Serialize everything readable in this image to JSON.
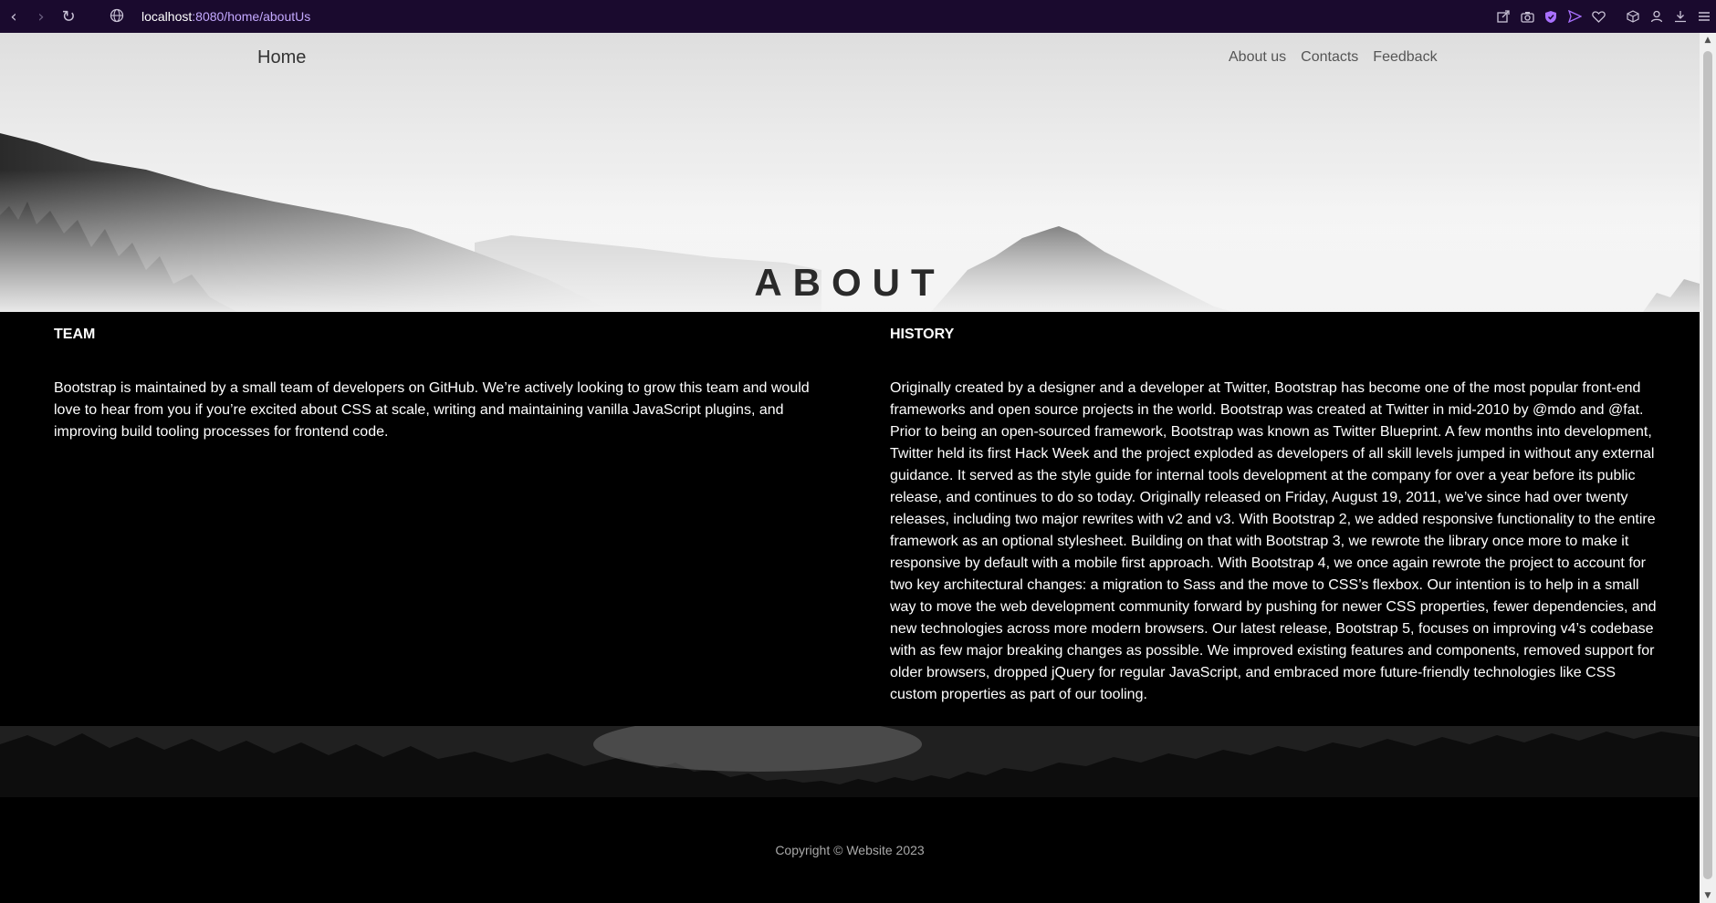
{
  "browser": {
    "url_host": "localhost",
    "url_path": ":8080/home/aboutUs",
    "back_icon": "‹",
    "forward_icon": "›",
    "reload_icon": "↻",
    "icons": [
      "share-icon",
      "camera-icon",
      "shield-icon",
      "send-icon",
      "heart-icon",
      "box-icon",
      "profile-icon",
      "download-icon",
      "menu-icon"
    ]
  },
  "nav": {
    "home": "Home",
    "links": [
      "About us",
      "Contacts",
      "Feedback"
    ]
  },
  "hero": {
    "title": "ABOUT"
  },
  "team": {
    "title": "TEAM",
    "text": "Bootstrap is maintained by a small team of developers on GitHub. We’re actively looking to grow this team and would love to hear from you if you’re excited about CSS at scale, writing and maintaining vanilla JavaScript plugins, and improving build tooling processes for frontend code."
  },
  "history": {
    "title": "HISTORY",
    "text": "Originally created by a designer and a developer at Twitter, Bootstrap has become one of the most popular front-end frameworks and open source projects in the world. Bootstrap was created at Twitter in mid-2010 by @mdo and @fat. Prior to being an open-sourced framework, Bootstrap was known as Twitter Blueprint. A few months into development, Twitter held its first Hack Week and the project exploded as developers of all skill levels jumped in without any external guidance. It served as the style guide for internal tools development at the company for over a year before its public release, and continues to do so today. Originally released on Friday, August 19, 2011, we’ve since had over twenty releases, including two major rewrites with v2 and v3. With Bootstrap 2, we added responsive functionality to the entire framework as an optional stylesheet. Building on that with Bootstrap 3, we rewrote the library once more to make it responsive by default with a mobile first approach. With Bootstrap 4, we once again rewrote the project to account for two key architectural changes: a migration to Sass and the move to CSS’s flexbox. Our intention is to help in a small way to move the web development community forward by pushing for newer CSS properties, fewer dependencies, and new technologies across more modern browsers. Our latest release, Bootstrap 5, focuses on improving v4’s codebase with as few major breaking changes as possible. We improved existing features and components, removed support for older browsers, dropped jQuery for regular JavaScript, and embraced more future-friendly technologies like CSS custom properties as part of our tooling."
  },
  "footer": {
    "copyright": "Copyright © Website 2023"
  },
  "colors": {
    "chrome_bg": "#1a0a2e",
    "accent": "#a970ff",
    "content_bg": "#000000"
  }
}
